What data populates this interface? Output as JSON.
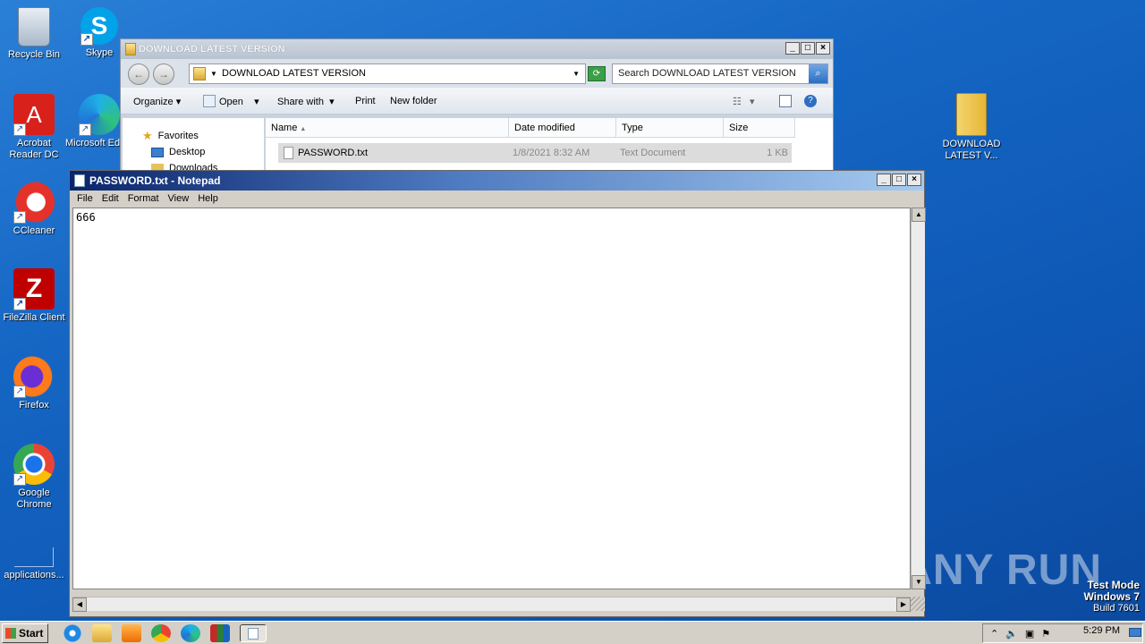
{
  "desktop": {
    "icons": [
      {
        "label": "Recycle Bin"
      },
      {
        "label": "Skype"
      },
      {
        "label": "Acrobat Reader DC"
      },
      {
        "label": "Microsoft Edge"
      },
      {
        "label": "CCleaner"
      },
      {
        "label": "FileZilla Client"
      },
      {
        "label": "Firefox"
      },
      {
        "label": "Google Chrome"
      },
      {
        "label": "applications..."
      },
      {
        "label": "DOWNLOAD LATEST V..."
      }
    ],
    "watermark": "ANY RUN",
    "test_mode": {
      "line1": "Test Mode",
      "line2": "Windows 7",
      "line3": "Build 7601"
    }
  },
  "explorer": {
    "title": "DOWNLOAD LATEST VERSION",
    "address": "DOWNLOAD LATEST VERSION",
    "search_placeholder": "Search DOWNLOAD LATEST VERSION",
    "toolbar": {
      "organize": "Organize",
      "open": "Open",
      "share_with": "Share with",
      "print": "Print",
      "new_folder": "New folder"
    },
    "nav": {
      "favorites": "Favorites",
      "desktop": "Desktop",
      "downloads": "Downloads"
    },
    "columns": {
      "name": "Name",
      "date": "Date modified",
      "type": "Type",
      "size": "Size"
    },
    "file": {
      "name": "PASSWORD.txt",
      "date": "1/8/2021 8:32 AM",
      "type": "Text Document",
      "size": "1 KB"
    }
  },
  "notepad": {
    "title": "PASSWORD.txt - Notepad",
    "menu": {
      "file": "File",
      "edit": "Edit",
      "format": "Format",
      "view": "View",
      "help": "Help"
    },
    "content": "666"
  },
  "taskbar": {
    "start": "Start",
    "clock": "5:29 PM"
  }
}
